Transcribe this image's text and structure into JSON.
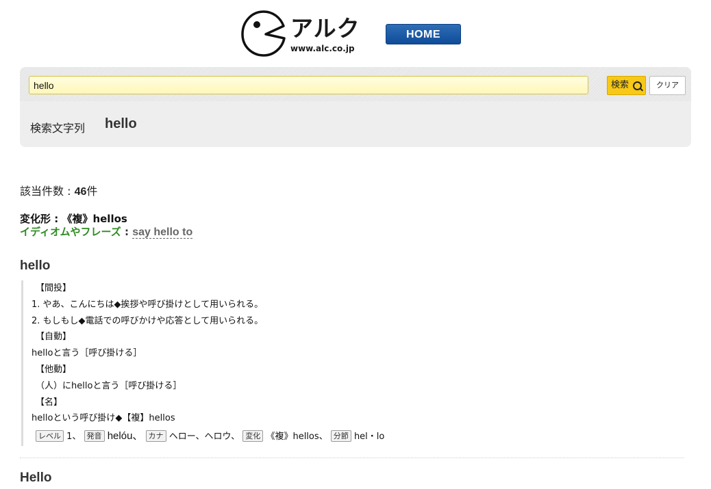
{
  "header": {
    "logo_text": "アルク",
    "logo_url": "www.alc.co.jp",
    "home_label": "HOME"
  },
  "search": {
    "input_value": "hello",
    "search_button": "検索",
    "clear_button": "クリア",
    "query_label": "検索文字列",
    "query_value": "hello"
  },
  "results": {
    "count_label": "該当件数 : ",
    "count_value": "46",
    "count_unit": "件",
    "inflection_label": "変化形 : ",
    "inflection_value": "《複》hellos",
    "idiom_label": "イディオムやフレーズ",
    "idiom_sep": " : ",
    "idiom_link": "say hello to"
  },
  "entries": [
    {
      "headword": "hello",
      "lines": [
        "【間投】",
        "1. やあ、こんにちは◆挨拶や呼び掛けとして用いられる。",
        "2. もしもし◆電話での呼びかけや応答として用いられる。",
        "【自動】",
        "helloと言う［呼び掛ける］",
        "【他動】",
        "（人）にhelloと言う［呼び掛ける］",
        "【名】",
        "helloという呼び掛け◆【複】hellos"
      ],
      "meta": {
        "level_tag": "レベル",
        "level_value": "1、",
        "pron_tag": "発音",
        "pron_value": "helóu、",
        "kana_tag": "カナ",
        "kana_value": "ヘロー、ヘロウ、",
        "change_tag": "変化",
        "change_value": "《複》hellos、",
        "syllable_tag": "分節",
        "syllable_value": "hel・lo"
      }
    },
    {
      "headword": "Hello"
    }
  ],
  "colors": {
    "home_button": "#0f4c99",
    "search_button": "#f7c916",
    "idiom_green": "#2e8b22"
  },
  "icons": {
    "logo": "pacman-face-icon",
    "search": "magnifier-icon"
  }
}
